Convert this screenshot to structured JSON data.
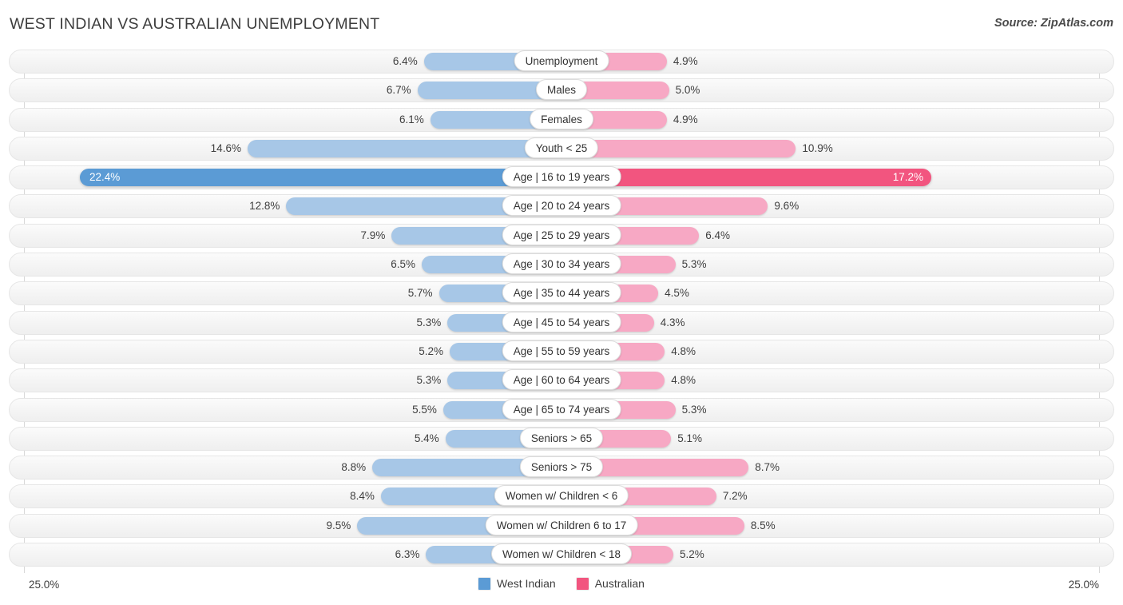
{
  "header": {
    "title": "WEST INDIAN VS AUSTRALIAN UNEMPLOYMENT",
    "source": "Source: ZipAtlas.com"
  },
  "legend": {
    "items": [
      {
        "label": "West Indian",
        "color": "#5b9bd5"
      },
      {
        "label": "Australian",
        "color": "#f2557f"
      }
    ]
  },
  "axis": {
    "left_label": "25.0%",
    "right_label": "25.0%",
    "max": 25.0
  },
  "chart_data": {
    "type": "bar",
    "orientation": "horizontal",
    "style": "diverging-bidirectional",
    "title": "WEST INDIAN VS AUSTRALIAN UNEMPLOYMENT",
    "subtitle": "",
    "xlabel": "",
    "ylabel": "",
    "xlim": [
      25.0,
      25.0
    ],
    "grid": false,
    "legend_position": "bottom-center",
    "source": "Source: ZipAtlas.com",
    "colors": {
      "left_series": "#a7c7e7",
      "right_series": "#f7a8c4",
      "left_series_highlight": "#5b9bd5",
      "right_series_highlight": "#f2557f"
    },
    "series": [
      {
        "name": "West Indian",
        "side": "left",
        "color": "#a7c7e7",
        "values": [
          6.4,
          6.7,
          6.1,
          14.6,
          22.4,
          12.8,
          7.9,
          6.5,
          5.7,
          5.3,
          5.2,
          5.3,
          5.5,
          5.4,
          8.8,
          8.4,
          9.5,
          6.3
        ]
      },
      {
        "name": "Australian",
        "side": "right",
        "color": "#f7a8c4",
        "values": [
          4.9,
          5.0,
          4.9,
          10.9,
          17.2,
          9.6,
          6.4,
          5.3,
          4.5,
          4.3,
          4.8,
          4.8,
          5.3,
          5.1,
          8.7,
          7.2,
          8.5,
          5.2
        ]
      }
    ],
    "categories": [
      "Unemployment",
      "Males",
      "Females",
      "Youth < 25",
      "Age | 16 to 19 years",
      "Age | 20 to 24 years",
      "Age | 25 to 29 years",
      "Age | 30 to 34 years",
      "Age | 35 to 44 years",
      "Age | 45 to 54 years",
      "Age | 55 to 59 years",
      "Age | 60 to 64 years",
      "Age | 65 to 74 years",
      "Seniors > 65",
      "Seniors > 75",
      "Women w/ Children < 6",
      "Women w/ Children 6 to 17",
      "Women w/ Children < 18"
    ]
  },
  "rows": [
    {
      "label": "Unemployment",
      "left": 6.4,
      "right": 4.9,
      "left_text": "6.4%",
      "right_text": "4.9%",
      "highlight": false
    },
    {
      "label": "Males",
      "left": 6.7,
      "right": 5.0,
      "left_text": "6.7%",
      "right_text": "5.0%",
      "highlight": false
    },
    {
      "label": "Females",
      "left": 6.1,
      "right": 4.9,
      "left_text": "6.1%",
      "right_text": "4.9%",
      "highlight": false
    },
    {
      "label": "Youth < 25",
      "left": 14.6,
      "right": 10.9,
      "left_text": "14.6%",
      "right_text": "10.9%",
      "highlight": false
    },
    {
      "label": "Age | 16 to 19 years",
      "left": 22.4,
      "right": 17.2,
      "left_text": "22.4%",
      "right_text": "17.2%",
      "highlight": true
    },
    {
      "label": "Age | 20 to 24 years",
      "left": 12.8,
      "right": 9.6,
      "left_text": "12.8%",
      "right_text": "9.6%",
      "highlight": false
    },
    {
      "label": "Age | 25 to 29 years",
      "left": 7.9,
      "right": 6.4,
      "left_text": "7.9%",
      "right_text": "6.4%",
      "highlight": false
    },
    {
      "label": "Age | 30 to 34 years",
      "left": 6.5,
      "right": 5.3,
      "left_text": "6.5%",
      "right_text": "5.3%",
      "highlight": false
    },
    {
      "label": "Age | 35 to 44 years",
      "left": 5.7,
      "right": 4.5,
      "left_text": "5.7%",
      "right_text": "4.5%",
      "highlight": false
    },
    {
      "label": "Age | 45 to 54 years",
      "left": 5.3,
      "right": 4.3,
      "left_text": "5.3%",
      "right_text": "4.3%",
      "highlight": false
    },
    {
      "label": "Age | 55 to 59 years",
      "left": 5.2,
      "right": 4.8,
      "left_text": "5.2%",
      "right_text": "4.8%",
      "highlight": false
    },
    {
      "label": "Age | 60 to 64 years",
      "left": 5.3,
      "right": 4.8,
      "left_text": "5.3%",
      "right_text": "4.8%",
      "highlight": false
    },
    {
      "label": "Age | 65 to 74 years",
      "left": 5.5,
      "right": 5.3,
      "left_text": "5.5%",
      "right_text": "5.3%",
      "highlight": false
    },
    {
      "label": "Seniors > 65",
      "left": 5.4,
      "right": 5.1,
      "left_text": "5.4%",
      "right_text": "5.1%",
      "highlight": false
    },
    {
      "label": "Seniors > 75",
      "left": 8.8,
      "right": 8.7,
      "left_text": "8.8%",
      "right_text": "8.7%",
      "highlight": false
    },
    {
      "label": "Women w/ Children < 6",
      "left": 8.4,
      "right": 7.2,
      "left_text": "8.4%",
      "right_text": "7.2%",
      "highlight": false
    },
    {
      "label": "Women w/ Children 6 to 17",
      "left": 9.5,
      "right": 8.5,
      "left_text": "9.5%",
      "right_text": "8.5%",
      "highlight": false
    },
    {
      "label": "Women w/ Children < 18",
      "left": 6.3,
      "right": 5.2,
      "left_text": "6.3%",
      "right_text": "5.2%",
      "highlight": false
    }
  ]
}
